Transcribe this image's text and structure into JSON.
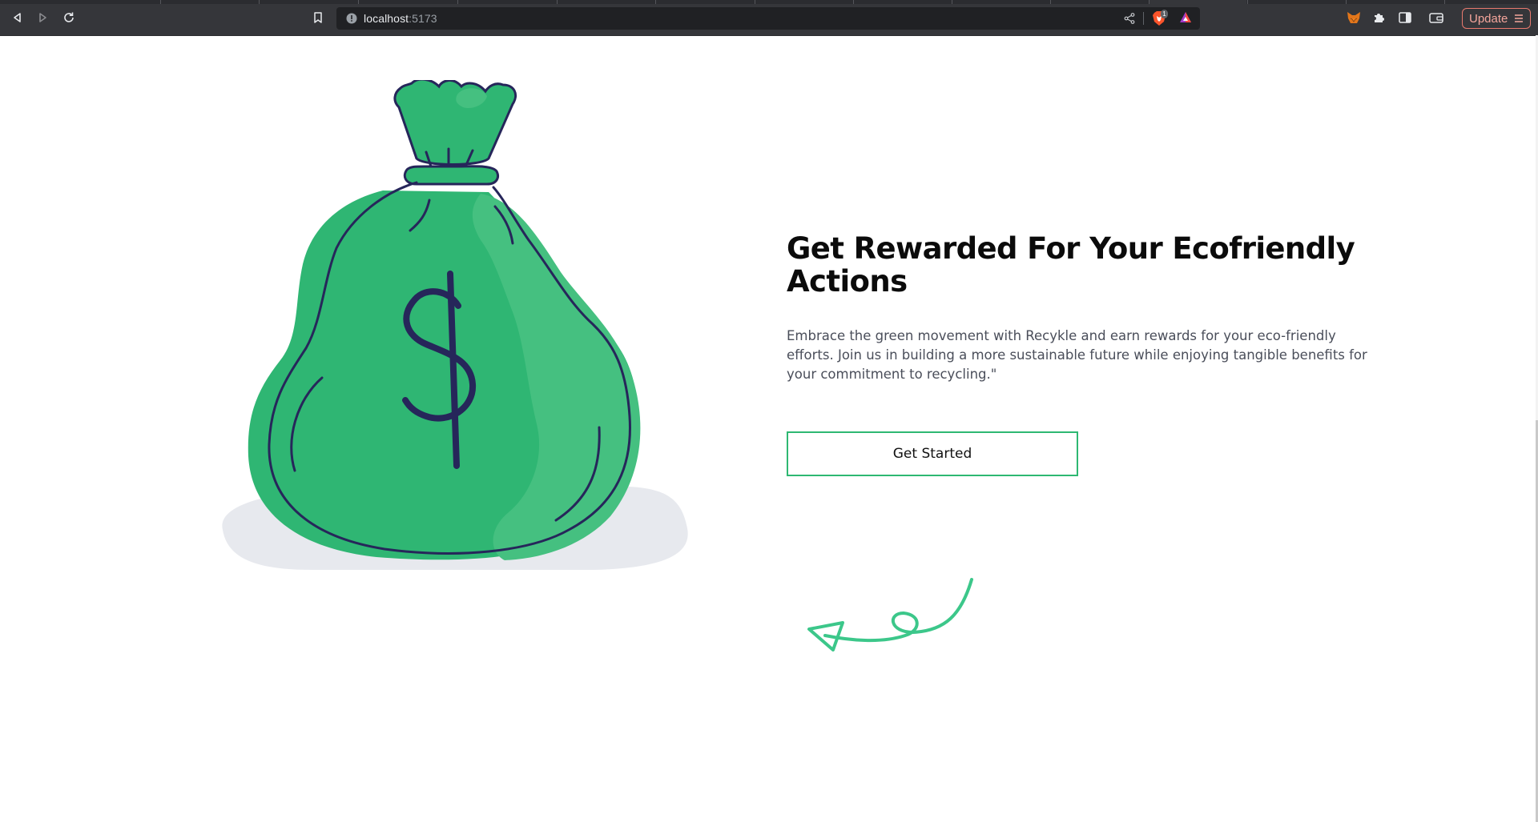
{
  "browser": {
    "url_host": "localhost",
    "url_port": ":5173",
    "update_label": "Update",
    "brave_badge": "1"
  },
  "hero": {
    "title": "Get Rewarded For Your Ecofriendly Actions",
    "description": "Embrace the green movement with Recykle and earn rewards for your eco-friendly efforts. Join us in building a more sustainable future while enjoying tangible benefits for your commitment to recycling.\"",
    "cta_label": "Get Started"
  },
  "illustration": {
    "symbol": "$"
  },
  "colors": {
    "accent": "#2eb872",
    "bag_green": "#2fb673",
    "bag_light": "#45c080",
    "outline": "#26265a",
    "shadow": "#e7e9ee",
    "arrow": "#3cc78a"
  }
}
